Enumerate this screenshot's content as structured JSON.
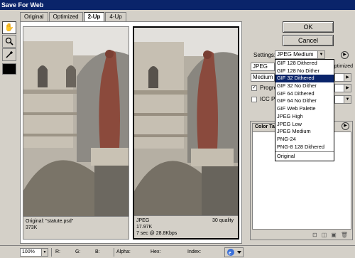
{
  "window": {
    "title": "Save For Web"
  },
  "tabs": [
    {
      "label": "Original"
    },
    {
      "label": "Optimized"
    },
    {
      "label": "2-Up"
    },
    {
      "label": "4-Up"
    }
  ],
  "active_tab": "2-Up",
  "tools": [
    "hand-icon",
    "zoom-icon",
    "eyedropper-icon"
  ],
  "panes": {
    "original": {
      "line1": "Original: \"statute.psd\"",
      "line2": "373K"
    },
    "optimized": {
      "format": "JPEG",
      "size": "17.97K",
      "time": "7 sec @ 28.8Kbps",
      "quality": "30 quality"
    }
  },
  "buttons": {
    "ok": "OK",
    "cancel": "Cancel"
  },
  "settings": {
    "label": "Settings:",
    "selected": "JPEG Medium",
    "format": "JPEG",
    "quality_level": "Medium",
    "progressive_label": "Progre",
    "icc_label": "ICC Pro",
    "optimized_label": "ptimized"
  },
  "settings_menu": [
    "GIF 128 Dithered",
    "GIF 128 No Dither",
    "GIF 32 Dithered",
    "GIF 32 No Dither",
    "GIF 64 Dithered",
    "GIF 64 No Dither",
    "GIF Web Palette",
    "JPEG High",
    "JPEG Low",
    "JPEG Medium",
    "PNG-24",
    "PNG-8 128 Dithered",
    "Original"
  ],
  "settings_menu_highlighted": "GIF 32 Dithered",
  "color_table": {
    "tab_label": "Color Ta"
  },
  "statusbar": {
    "zoom": "100%",
    "r": "R:",
    "g": "G:",
    "b": "B:",
    "alpha": "Alpha:",
    "hex": "Hex:",
    "index": "Index:"
  },
  "colors": {
    "selection": "#0a246a",
    "titlebar": "#0a246a",
    "chrome": "#d4d0c8"
  }
}
